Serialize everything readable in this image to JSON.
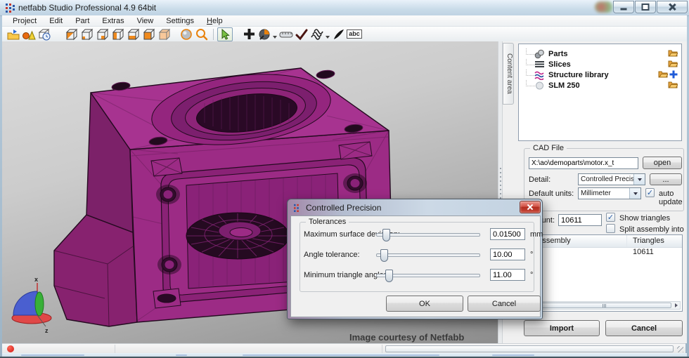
{
  "window": {
    "title": "netfabb Studio Professional 4.9 64bit"
  },
  "menu": {
    "items": [
      "Project",
      "Edit",
      "Part",
      "Extras",
      "View",
      "Settings"
    ],
    "help_accel": "H",
    "help_rest": "elp"
  },
  "toolbar": {
    "abc_label": "abc"
  },
  "viewport": {
    "credit": "Image courtesy of Netfabb",
    "axis_labels": {
      "x": "x",
      "z": "z"
    }
  },
  "context_tab": {
    "label": "Content area"
  },
  "tree": {
    "items": [
      "Parts",
      "Slices",
      "Structure library",
      "SLM 250"
    ]
  },
  "cad_file": {
    "group_label": "CAD File",
    "path": "X:\\ao\\demoparts\\motor.x_t",
    "open_label": "open",
    "detail_label": "Detail:",
    "detail_value": "Controlled Precision",
    "more_label": "...",
    "units_label": "Default units:",
    "units_value": "Millimeter",
    "auto_update_label": "auto update",
    "count_label": "Triangle count:",
    "count_value": "10611",
    "show_triangles_label": "Show triangles",
    "split_label": "Split assembly into parts"
  },
  "parts_table": {
    "columns": [
      "Assembly",
      "Triangles"
    ],
    "rows": [
      {
        "assembly": "",
        "triangles": "10611"
      }
    ]
  },
  "panel_actions": {
    "import_label": "Import",
    "cancel_label": "Cancel"
  },
  "dialog": {
    "title": "Controlled Precision",
    "group_label": "Tolerances",
    "rows": [
      {
        "label": "Maximum surface deviation:",
        "value": "0.01500",
        "unit": "mm"
      },
      {
        "label": "Angle tolerance:",
        "value": "10.00",
        "unit": "°"
      },
      {
        "label": "Minimum triangle angle:",
        "value": "11.00",
        "unit": "°"
      }
    ],
    "ok_label": "OK",
    "cancel_label": "Cancel"
  },
  "icons": {
    "check": "✓"
  },
  "colors": {
    "model_magenta": "#9c2b85",
    "accent_orange": "#f08a1d",
    "selection_green": "#7ac143"
  }
}
